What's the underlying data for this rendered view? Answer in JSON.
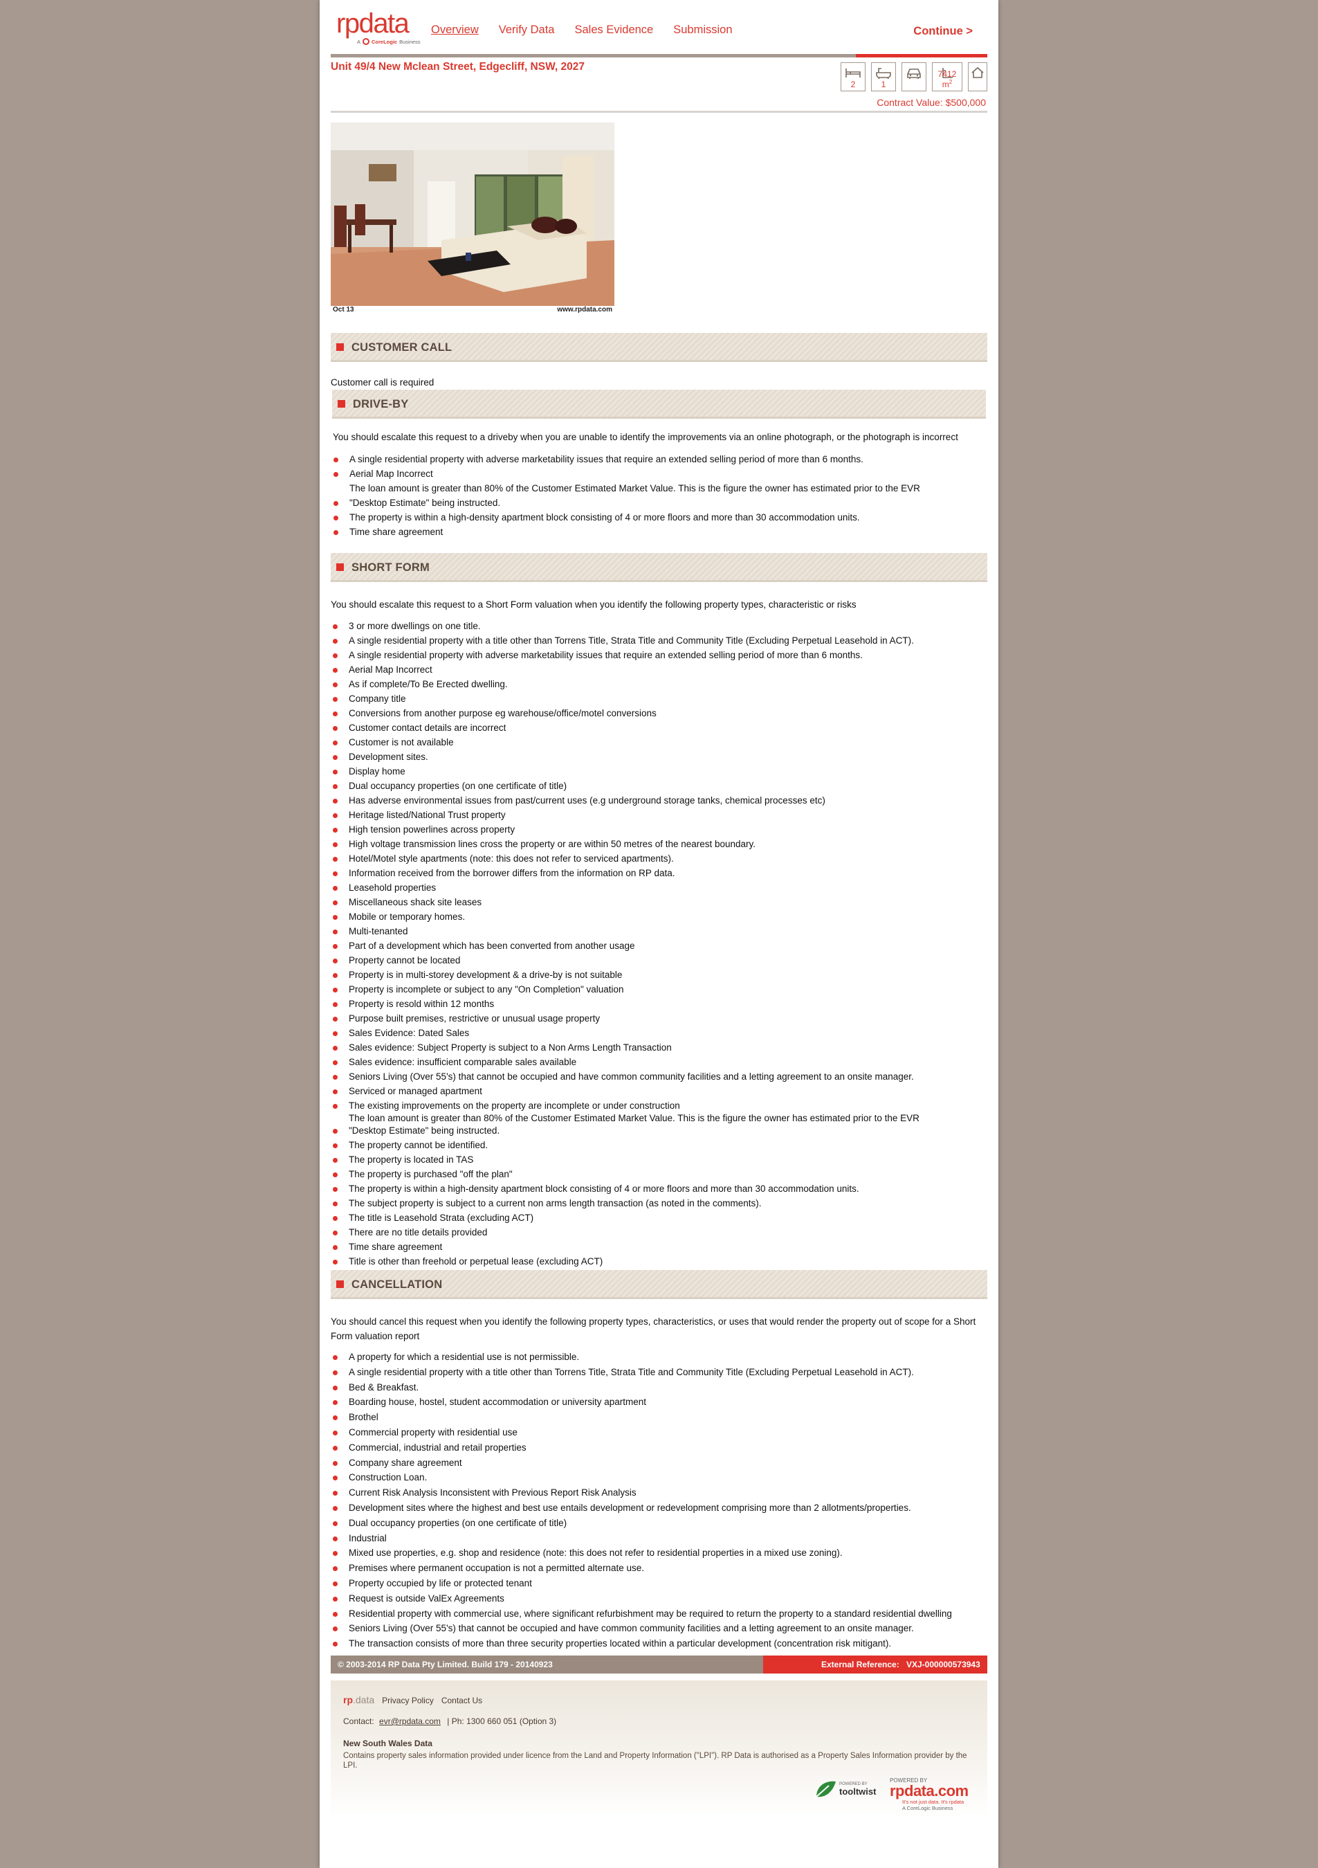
{
  "header": {
    "logo_text": "rpdata",
    "logo_sub_prefix": "A",
    "logo_sub_brand": "CoreLogic",
    "logo_sub_suffix": "Business",
    "nav": [
      "Overview",
      "Verify Data",
      "Sales Evidence",
      "Submission"
    ],
    "active_nav": "Overview",
    "continue_label": "Continue >",
    "progress_fraction": 0.2
  },
  "property": {
    "address": "Unit 49/4 New Mclean Street, Edgecliff, NSW, 2027",
    "bedrooms": "2",
    "bathrooms": "1",
    "car_spaces": "",
    "land_area": "7412 m",
    "land_area_sup": "2",
    "contract_value": "Contract Value:  $500,000",
    "photo_caption_left": "Oct 13",
    "photo_caption_right": "www.rpdata.com"
  },
  "customer_call": {
    "title": "CUSTOMER CALL",
    "text": "Customer call is required"
  },
  "drive_by": {
    "title": "DRIVE-BY",
    "intro": "You should escalate this request to a driveby when you are unable to identify the improvements via an online photograph, or the photograph is incorrect",
    "items": [
      {
        "text": "A single residential property with adverse marketability issues that require an extended selling period of more than 6 months.",
        "bullet": true
      },
      {
        "text": "Aerial Map Incorrect",
        "bullet": true
      },
      {
        "text": "The loan amount is greater than 80% of the Customer Estimated Market Value. This is the figure the owner has estimated prior to the EVR",
        "bullet": false
      },
      {
        "text": "\"Desktop Estimate\" being instructed.",
        "bullet": true
      },
      {
        "text": "The property is within a high-density apartment block consisting of 4 or more floors and more than 30 accommodation units.",
        "bullet": true
      },
      {
        "text": "Time share agreement",
        "bullet": true
      }
    ]
  },
  "short_form": {
    "title": "SHORT FORM",
    "intro": "You should escalate this request to a Short Form valuation when you identify the following property types, characteristic or risks",
    "items": [
      "3 or more dwellings on one title.",
      "A single residential property with a title other than Torrens Title, Strata Title and Community Title (Excluding Perpetual Leasehold in ACT).",
      "A single residential property with adverse marketability issues that require an extended selling period of more than 6 months.",
      "Aerial Map Incorrect",
      "As if complete/To Be Erected dwelling.",
      "Company title",
      "Conversions from another purpose eg warehouse/office/motel conversions",
      "Customer contact details are incorrect",
      "Customer is not available",
      "Development sites.",
      "Display home",
      "Dual occupancy properties (on one certificate of title)",
      "Has adverse environmental issues from past/current uses (e.g underground storage tanks, chemical processes etc)",
      "Heritage listed/National Trust property",
      "High tension powerlines across property",
      "High voltage transmission lines cross the property or are within 50 metres of the nearest boundary.",
      "Hotel/Motel style apartments (note: this does not refer to serviced apartments).",
      "Information received from the borrower differs from the information on RP data.",
      "Leasehold properties",
      "Miscellaneous shack site leases",
      "Mobile or temporary homes.",
      "Multi-tenanted",
      "Part of a development which has been converted from another usage",
      "Property cannot be located",
      "Property is in multi-storey development & a drive-by is not suitable",
      "Property is incomplete or subject to any \"On Completion\" valuation",
      "Property is resold within 12 months",
      "Purpose built premises, restrictive or unusual usage property",
      "Sales Evidence: Dated Sales",
      "Sales evidence: Subject Property is subject to a Non Arms Length Transaction",
      "Sales evidence: insufficient comparable sales available",
      "Seniors Living (Over 55's) that cannot be occupied and have common community facilities and a letting agreement to an onsite manager.",
      "Serviced or managed apartment",
      "The existing improvements on the property are incomplete or under construction"
    ],
    "loan_note": "The loan amount is greater than 80% of the Customer Estimated Market Value. This is the figure the owner has estimated prior to the EVR",
    "items_after": [
      "\"Desktop Estimate\" being instructed.",
      "The property cannot be identified.",
      "The property is located in TAS",
      "The property is purchased \"off the plan\"",
      "The property is within a high-density apartment block consisting of 4 or more floors and more than 30 accommodation units.",
      "The subject property is subject to a current non arms length transaction (as noted in the comments).",
      "The title is Leasehold Strata (excluding ACT)",
      "There are no title details provided",
      "Time share agreement",
      "Title is other than freehold or perpetual lease (excluding ACT)"
    ]
  },
  "cancellation": {
    "title": "CANCELLATION",
    "intro": "You should cancel this request when you identify the following property types, characteristics, or uses that would render the property out of scope for a Short Form valuation report",
    "items": [
      "A property for which a residential use is not permissible.",
      "A single residential property with a title other than Torrens Title, Strata Title and Community Title (Excluding Perpetual Leasehold in ACT).",
      "Bed & Breakfast.",
      "Boarding house, hostel, student accommodation or university apartment",
      "Brothel",
      "Commercial property with residential use",
      "Commercial, industrial and retail properties",
      "Company share agreement",
      "Construction Loan.",
      "Current Risk Analysis Inconsistent with Previous Report Risk Analysis",
      "Development sites where the highest and best use entails development or redevelopment comprising more than 2 allotments/properties.",
      "Dual occupancy properties (on one certificate of title)",
      "Industrial",
      "Mixed use properties, e.g. shop and residence (note: this does not refer to residential properties in a mixed use zoning).",
      "Premises where permanent occupation is not a permitted alternate use.",
      "Property occupied by life or protected tenant",
      "Request is outside ValEx Agreements",
      "Residential property with commercial use, where significant refurbishment may be required to return the property to a standard residential dwelling",
      "Seniors Living (Over 55's) that cannot be occupied and have common community facilities and a letting agreement to an onsite manager.",
      "The transaction consists of more than three security properties located within a particular development (concentration risk mitigant)."
    ]
  },
  "footer": {
    "copyright": "© 2003-2014 RP Data Pty Limited. Build 179 - 20140923",
    "ext_ref_label": "External Reference:",
    "ext_ref_value": "VXJ-000000573943",
    "brand_a": "rp",
    "brand_b": ".data",
    "privacy": "Privacy Policy",
    "contact_us": "Contact Us",
    "contact_label": "Contact:",
    "email": "evr@rpdata.com",
    "phone": "|  Ph: 1300 660 051 (Option 3)",
    "nsw_title": "New South Wales Data",
    "nsw_text": "Contains property sales information provided under licence from the Land and Property Information (\"LPI\"). RP Data is authorised as a Property Sales Information provider by the LPI.",
    "tooltwist_small": "POWERED BY",
    "tooltwist": "tooltwist",
    "powered_by": "POWERED BY",
    "rpdata_com": "rpdata.com",
    "tagline": "It's not just data. It's rpdata",
    "corelogic": "A  CoreLogic Business"
  },
  "colors": {
    "accent": "#e0312b",
    "brand": "#d93a30",
    "taupe": "#a79990"
  }
}
